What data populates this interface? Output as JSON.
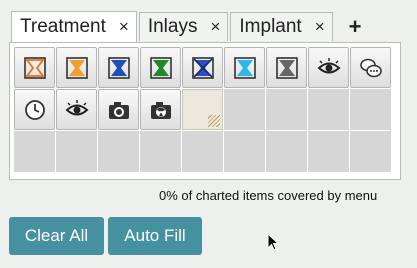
{
  "tabs": [
    {
      "label": "Treatment",
      "close": "×"
    },
    {
      "label": "Inlays",
      "close": "×"
    },
    {
      "label": "Implant",
      "close": "×"
    }
  ],
  "add_tab_label": "+",
  "grid": {
    "rows": 3,
    "columns": 9,
    "items": [
      {
        "icon": "tooth-hourglass-orange-outline-icon",
        "color": "#e8731a"
      },
      {
        "icon": "tooth-hourglass-orange-icon",
        "color": "#f0a030"
      },
      {
        "icon": "tooth-hourglass-blue-icon",
        "color": "#1f4fb8"
      },
      {
        "icon": "tooth-hourglass-green-icon",
        "color": "#1e8a2a"
      },
      {
        "icon": "tooth-hourglass-blue-x-icon",
        "color": "#2a4fc0"
      },
      {
        "icon": "tooth-hourglass-cyan-icon",
        "color": "#2cb8e6"
      },
      {
        "icon": "tooth-hourglass-gray-icon",
        "color": "#666666"
      },
      {
        "icon": "eye-icon"
      },
      {
        "icon": "chat-bubbles-icon"
      },
      {
        "icon": "clock-icon"
      },
      {
        "icon": "eye-icon"
      },
      {
        "icon": "camera-icon"
      },
      {
        "icon": "camera-radiation-icon"
      }
    ]
  },
  "status_text": "0% of charted items covered by menu",
  "buttons": {
    "clear_all": "Clear All",
    "auto_fill": "Auto Fill"
  }
}
